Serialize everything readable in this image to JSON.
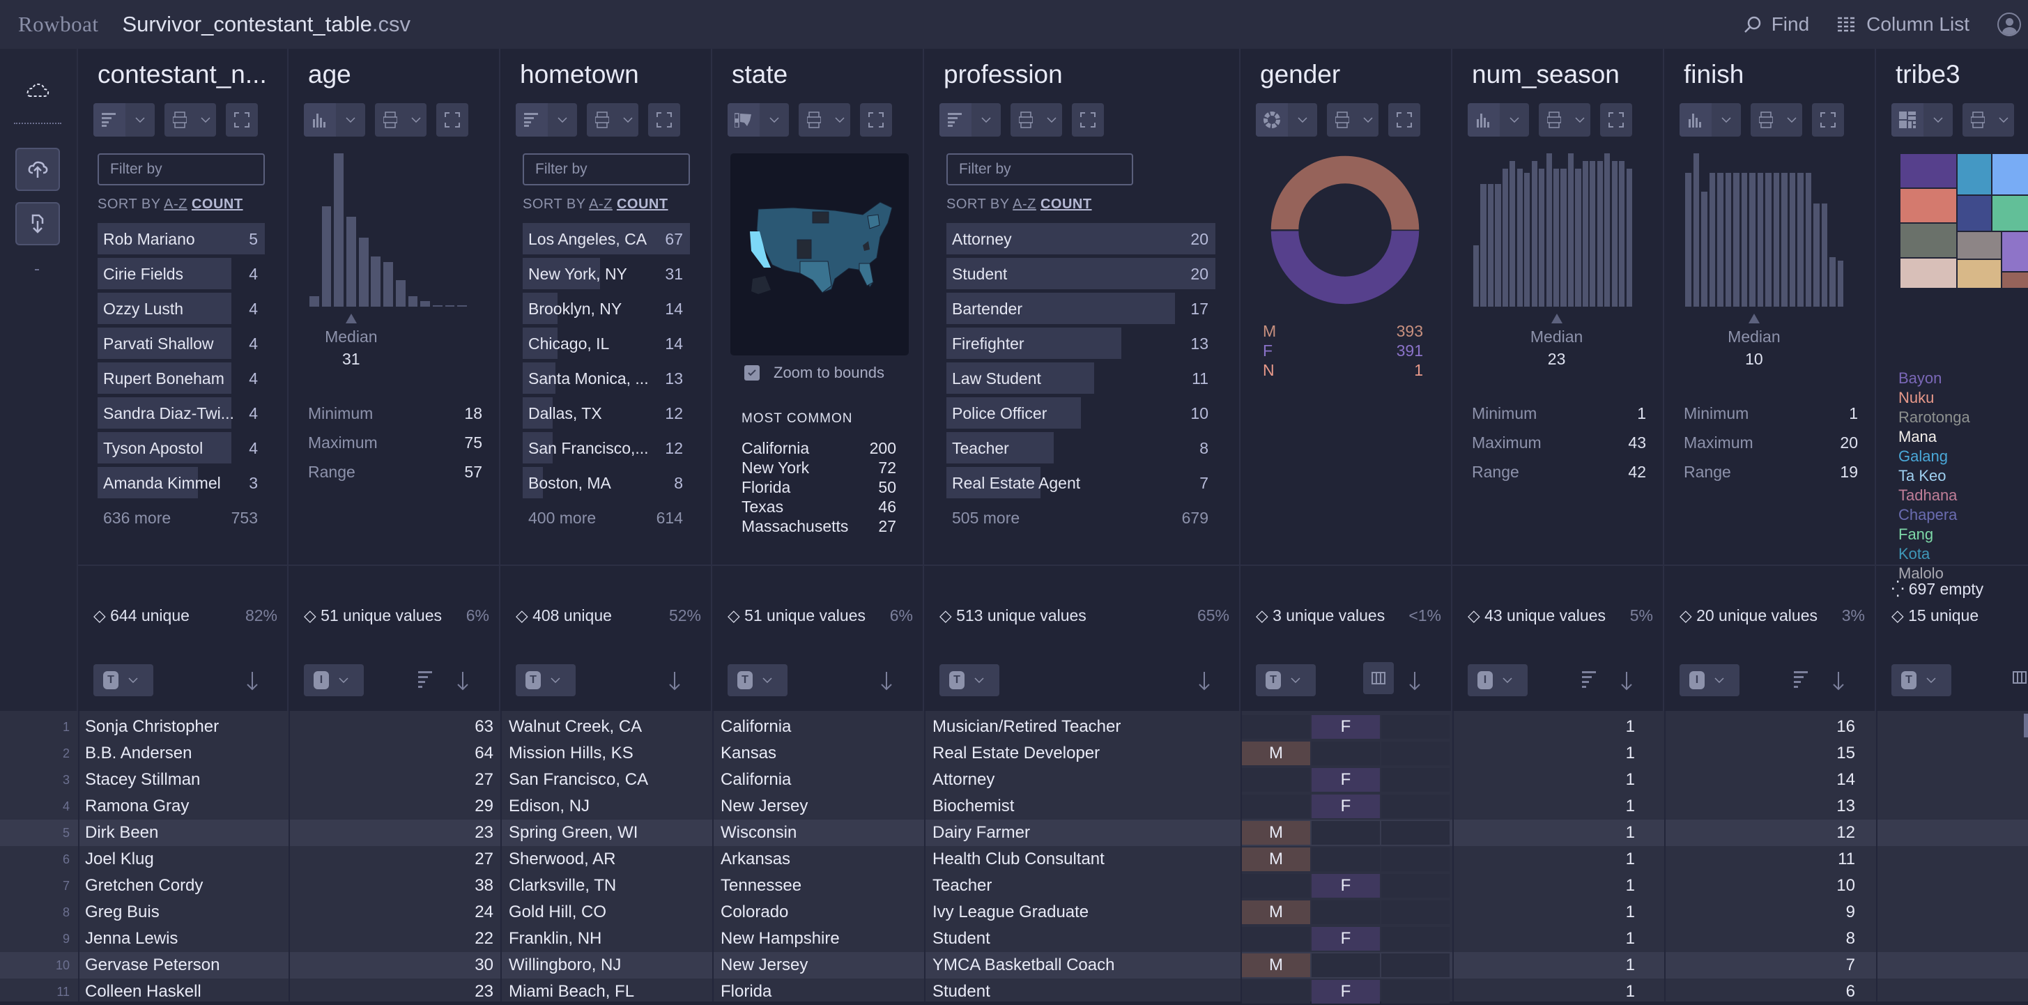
{
  "app": {
    "brand": "Rowboat",
    "file_base": "Survivor_contestant_table",
    "file_ext": ".csv",
    "find_label": "Find",
    "column_list_label": "Column List"
  },
  "rail": {
    "icons": [
      "cloud-dashed-icon",
      "upload-cloud-icon",
      "download-file-icon"
    ]
  },
  "common": {
    "filter_placeholder": "Filter by",
    "sort_by": "SORT BY",
    "sort_az": "A-Z",
    "sort_count": "COUNT",
    "median": "Median",
    "minimum": "Minimum",
    "maximum": "Maximum",
    "range": "Range",
    "zoom_to_bounds": "Zoom to bounds",
    "most_common": "MOST COMMON"
  },
  "columns": {
    "contestant_name": {
      "title": "contestant_n...",
      "type_glyph": "T",
      "top": [
        {
          "label": "Rob Mariano",
          "count": 5
        },
        {
          "label": "Cirie Fields",
          "count": 4
        },
        {
          "label": "Ozzy Lusth",
          "count": 4
        },
        {
          "label": "Parvati Shallow",
          "count": 4
        },
        {
          "label": "Rupert Boneham",
          "count": 4
        },
        {
          "label": "Sandra Diaz-Twi...",
          "count": 4
        },
        {
          "label": "Tyson Apostol",
          "count": 4
        },
        {
          "label": "Amanda Kimmel",
          "count": 3
        }
      ],
      "more_label": "636 more",
      "more_count": "753",
      "unique": "644 unique",
      "unique_pct": "82%"
    },
    "age": {
      "title": "age",
      "type_glyph": "I",
      "histogram": [
        4,
        38,
        58,
        34,
        26,
        19,
        17,
        10,
        4,
        2,
        0.3,
        0.3,
        0.3
      ],
      "median_fraction": 0.26,
      "median": "31",
      "min": "18",
      "max": "75",
      "range": "57",
      "unique": "51 unique values",
      "unique_pct": "6%"
    },
    "hometown": {
      "title": "hometown",
      "type_glyph": "T",
      "top": [
        {
          "label": "Los Angeles, CA",
          "count": 67
        },
        {
          "label": "New York, NY",
          "count": 31
        },
        {
          "label": "Brooklyn, NY",
          "count": 14
        },
        {
          "label": "Chicago, IL",
          "count": 14
        },
        {
          "label": "Santa Monica, ...",
          "count": 13
        },
        {
          "label": "Dallas, TX",
          "count": 12
        },
        {
          "label": "San Francisco,...",
          "count": 12
        },
        {
          "label": "Boston, MA",
          "count": 8
        }
      ],
      "more_label": "400 more",
      "more_count": "614",
      "unique": "408 unique",
      "unique_pct": "52%"
    },
    "state": {
      "title": "state",
      "type_glyph": "T",
      "most_common": [
        {
          "label": "California",
          "count": 200
        },
        {
          "label": "New York",
          "count": 72
        },
        {
          "label": "Florida",
          "count": 50
        },
        {
          "label": "Texas",
          "count": 46
        },
        {
          "label": "Massachusetts",
          "count": 27
        }
      ],
      "unique": "51 unique values",
      "unique_pct": "6%"
    },
    "profession": {
      "title": "profession",
      "type_glyph": "T",
      "top": [
        {
          "label": "Attorney",
          "count": 20
        },
        {
          "label": "Student",
          "count": 20
        },
        {
          "label": "Bartender",
          "count": 17
        },
        {
          "label": "Firefighter",
          "count": 13
        },
        {
          "label": "Law Student",
          "count": 11
        },
        {
          "label": "Police Officer",
          "count": 10
        },
        {
          "label": "Teacher",
          "count": 8
        },
        {
          "label": "Real Estate Agent",
          "count": 7
        }
      ],
      "more_label": "505 more",
      "more_count": "679",
      "unique": "513 unique values",
      "unique_pct": "65%"
    },
    "gender": {
      "title": "gender",
      "type_glyph": "T",
      "slices": [
        {
          "label": "M",
          "count": 393,
          "color": "#96635a",
          "text_color": "#c8907f"
        },
        {
          "label": "F",
          "count": 391,
          "color": "#56408c",
          "text_color": "#8a72c8"
        },
        {
          "label": "N",
          "count": 1,
          "color": "#e8998a",
          "text_color": "#e8998a"
        }
      ],
      "unique": "3 unique values",
      "unique_pct": "<1%"
    },
    "num_season": {
      "title": "num_season",
      "type_glyph": "I",
      "histogram": [
        16,
        32,
        32,
        32,
        36,
        38,
        36,
        35,
        38,
        36,
        40,
        36,
        36,
        40,
        36,
        38,
        38,
        38,
        40,
        38,
        38,
        36
      ],
      "median_fraction": 0.52,
      "median": "23",
      "min": "1",
      "max": "43",
      "range": "42",
      "unique": "43 unique values",
      "unique_pct": "5%"
    },
    "finish": {
      "title": "finish",
      "type_glyph": "I",
      "histogram": [
        35,
        40,
        30,
        35,
        35,
        35,
        35,
        35,
        35,
        35,
        35,
        35,
        35,
        35,
        35,
        35,
        27,
        27,
        13,
        12
      ],
      "median_fraction": 0.43,
      "median": "10",
      "min": "1",
      "max": "20",
      "range": "19",
      "unique": "20 unique values",
      "unique_pct": "3%"
    },
    "tribe3": {
      "title": "tribe3",
      "type_glyph": "T",
      "legend": [
        {
          "label": "Bayon",
          "color": "#7b68b8"
        },
        {
          "label": "Nuku",
          "color": "#e8998a"
        },
        {
          "label": "Rarotonga",
          "color": "#8e9290"
        },
        {
          "label": "Mana",
          "color": "#f2eeea"
        },
        {
          "label": "Galang",
          "color": "#4aa8d8"
        },
        {
          "label": "Ta Keo",
          "color": "#9fd0f0"
        },
        {
          "label": "Tadhana",
          "color": "#c07e98"
        },
        {
          "label": "Chapera",
          "color": "#6a6cb0"
        },
        {
          "label": "Fang",
          "color": "#7ed8a8"
        },
        {
          "label": "Kota",
          "color": "#3f98b8"
        },
        {
          "label": "Malolo",
          "color": "#a9a9b2"
        }
      ],
      "empty": "697 empty",
      "unique": "15 unique"
    }
  },
  "rows": [
    {
      "n": "1",
      "name": "Sonja Christopher",
      "age": "63",
      "hometown": "Walnut Creek,  CA",
      "state": "California",
      "profession": "Musician/Retired Teacher",
      "gender": "F",
      "num_season": "1",
      "finish": "16"
    },
    {
      "n": "2",
      "name": "B.B. Andersen",
      "age": "64",
      "hometown": "Mission Hills,  KS",
      "state": "Kansas",
      "profession": "Real Estate Developer",
      "gender": "M",
      "num_season": "1",
      "finish": "15"
    },
    {
      "n": "3",
      "name": "Stacey Stillman",
      "age": "27",
      "hometown": "San Francisco,  CA",
      "state": "California",
      "profession": "Attorney",
      "gender": "F",
      "num_season": "1",
      "finish": "14"
    },
    {
      "n": "4",
      "name": "Ramona Gray",
      "age": "29",
      "hometown": "Edison,  NJ",
      "state": "New Jersey",
      "profession": "Biochemist",
      "gender": "F",
      "num_season": "1",
      "finish": "13"
    },
    {
      "n": "5",
      "name": "Dirk Been",
      "age": "23",
      "hometown": "Spring Green,  WI",
      "state": "Wisconsin",
      "profession": "Dairy Farmer",
      "gender": "M",
      "num_season": "1",
      "finish": "12"
    },
    {
      "n": "6",
      "name": "Joel Klug",
      "age": "27",
      "hometown": "Sherwood,  AR",
      "state": "Arkansas",
      "profession": "Health Club Consultant",
      "gender": "M",
      "num_season": "1",
      "finish": "11"
    },
    {
      "n": "7",
      "name": "Gretchen Cordy",
      "age": "38",
      "hometown": "Clarksville,  TN",
      "state": "Tennessee",
      "profession": "Teacher",
      "gender": "F",
      "num_season": "1",
      "finish": "10"
    },
    {
      "n": "8",
      "name": "Greg Buis",
      "age": "24",
      "hometown": "Gold Hill,  CO",
      "state": "Colorado",
      "profession": "Ivy League Graduate",
      "gender": "M",
      "num_season": "1",
      "finish": "9"
    },
    {
      "n": "9",
      "name": "Jenna Lewis",
      "age": "22",
      "hometown": "Franklin,  NH",
      "state": "New Hampshire",
      "profession": "Student",
      "gender": "F",
      "num_season": "1",
      "finish": "8"
    },
    {
      "n": "10",
      "name": "Gervase Peterson",
      "age": "30",
      "hometown": "Willingboro,  NJ",
      "state": "New Jersey",
      "profession": "YMCA Basketball Coach",
      "gender": "M",
      "num_season": "1",
      "finish": "7"
    },
    {
      "n": "11",
      "name": "Colleen Haskell",
      "age": "23",
      "hometown": "Miami Beach,  FL",
      "state": "Florida",
      "profession": "Student",
      "gender": "F",
      "num_season": "1",
      "finish": "6"
    }
  ],
  "highlighted_rows": [
    5,
    10
  ]
}
